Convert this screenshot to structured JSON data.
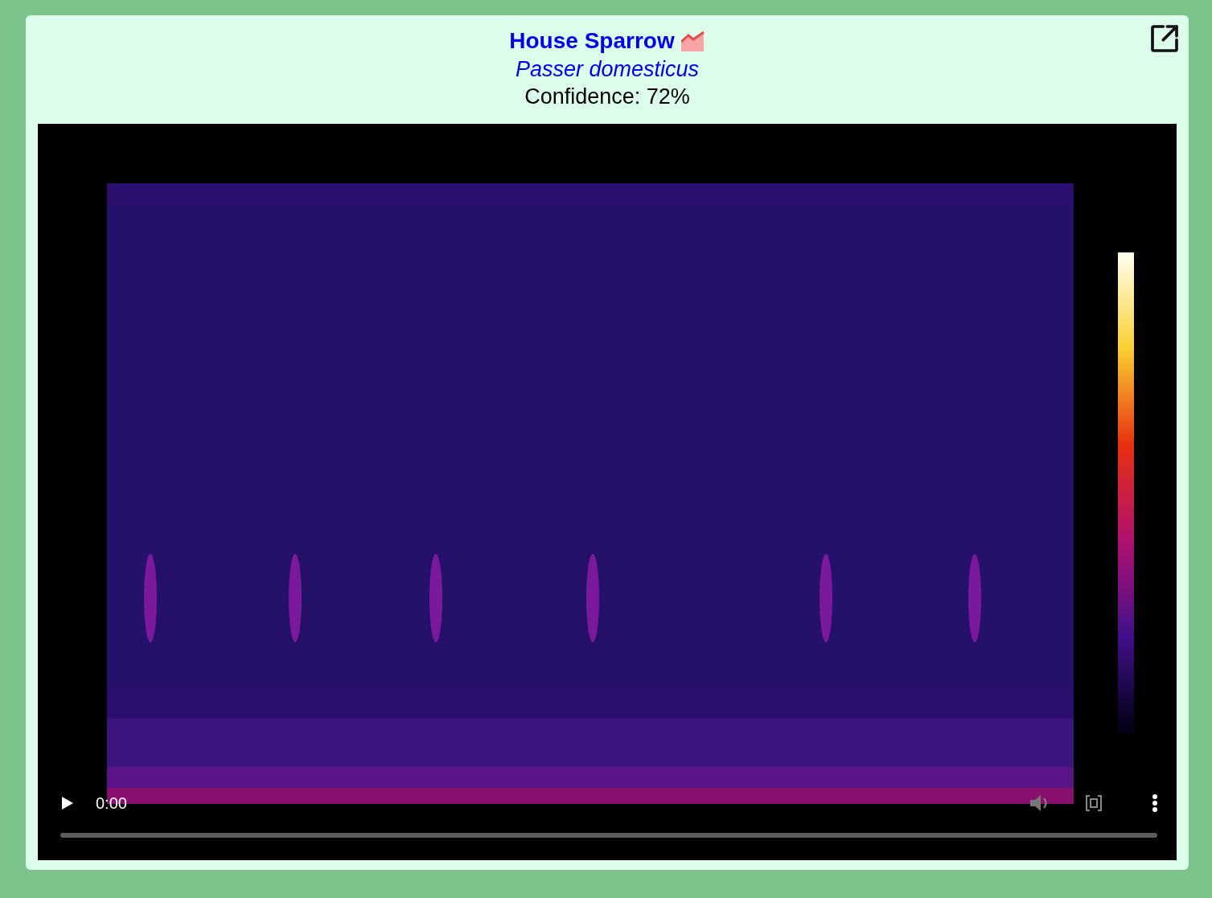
{
  "detection": {
    "common_name": "House Sparrow",
    "scientific_name": "Passer domesticus",
    "confidence": "Confidence: 72%"
  },
  "video": {
    "kind": "picture",
    "time": "0:00",
    "progress": {
      "level": 0
    }
  }
}
